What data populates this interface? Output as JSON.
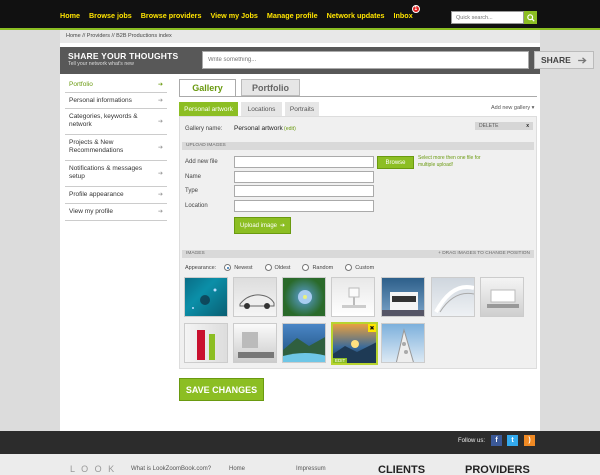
{
  "nav": {
    "items": [
      "Home",
      "Browse jobs",
      "Browse providers",
      "View my Jobs",
      "Manage profile",
      "Network updates",
      "Inbox"
    ],
    "inbox_count": "1",
    "search_placeholder": "Quick search..."
  },
  "breadcrumb": "Home // Providers // B2B Productions index",
  "share": {
    "title": "SHARE YOUR THOUGHTS",
    "subtitle": "Tell your network what's new",
    "placeholder": "Write something...",
    "button": "SHARE"
  },
  "sidebar": {
    "items": [
      "Portfolio",
      "Personal informations",
      "Categories, keywords & network",
      "Projects & New Recommendations",
      "Notifications & messages setup",
      "Profile appearance",
      "View my profile"
    ]
  },
  "tabs": {
    "gallery": "Gallery",
    "portfolio": "Portfolio"
  },
  "subtabs": {
    "personal": "Personal artwork",
    "locations": "Locations",
    "portraits": "Portraits",
    "add": "Add new gallery"
  },
  "gallery": {
    "name_label": "Gallery name:",
    "name_value": "Personal artwork",
    "edit": "(edit)",
    "delete": "DELETE"
  },
  "upload": {
    "section": "UPLOAD IMAGES",
    "file_label": "Add new file",
    "name_label": "Name",
    "type_label": "Type",
    "location_label": "Location",
    "browse": "Browse",
    "hint": "Select more then one file for multiple upload!",
    "button": "Upload image"
  },
  "images": {
    "section": "IMAGES",
    "drag_hint": "+ DRAG IMAGES TO CHANGE POSITION",
    "appearance_label": "Appearance:",
    "options": [
      "Newest",
      "Oldest",
      "Random",
      "Custom"
    ],
    "edit": "EDIT"
  },
  "save_button": "SAVE CHANGES",
  "footer": {
    "follow": "Follow us:",
    "logo": "L  O  O  K",
    "what": "What is LookZoomBook.com?",
    "home": "Home",
    "impressum": "Impressum",
    "clients": "CLIENTS",
    "providers": "PROVIDERS"
  }
}
